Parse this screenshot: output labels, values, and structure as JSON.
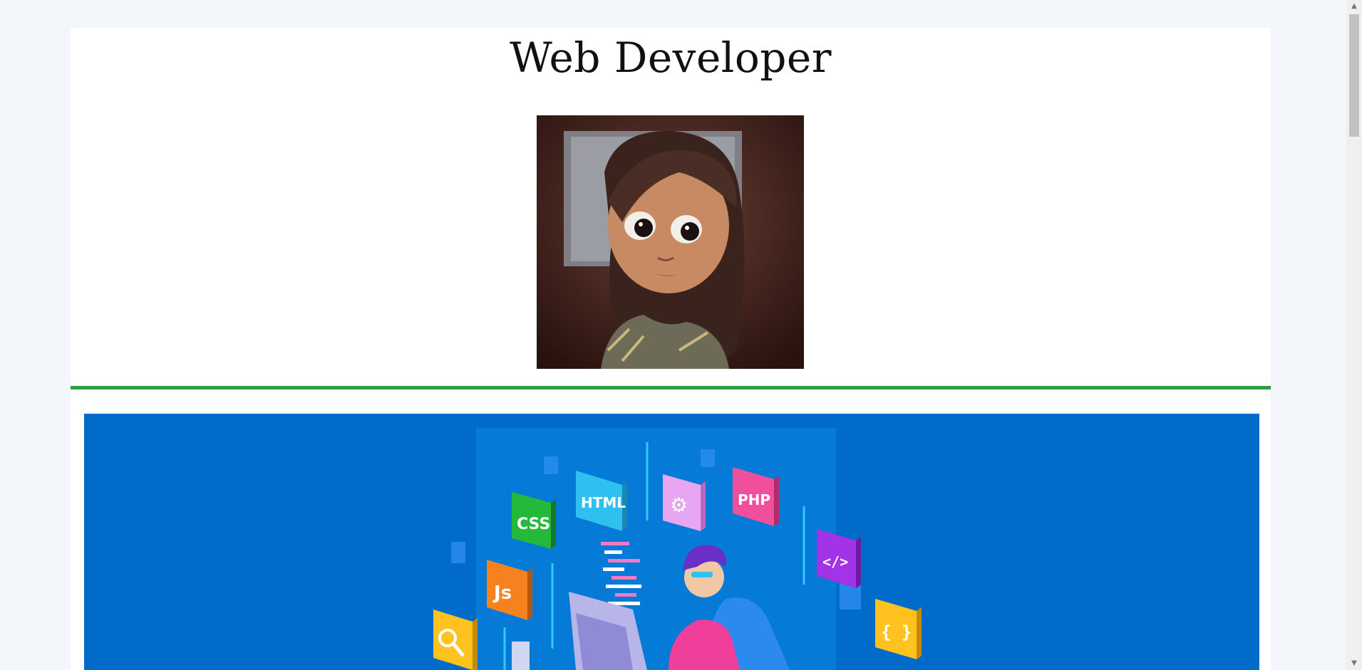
{
  "page": {
    "title": "Web Developer"
  },
  "hero": {
    "tiles": {
      "css": "CSS",
      "html": "HTML",
      "php": "PHP",
      "js": "Js",
      "code": "</>",
      "braces": "{ }"
    }
  },
  "scrollbar": {
    "up_arrow": "▲",
    "down_arrow": "▼"
  },
  "colors": {
    "background": "#f3f7fc",
    "divider": "#2e9e43",
    "hero_bg": "#016bc9"
  }
}
